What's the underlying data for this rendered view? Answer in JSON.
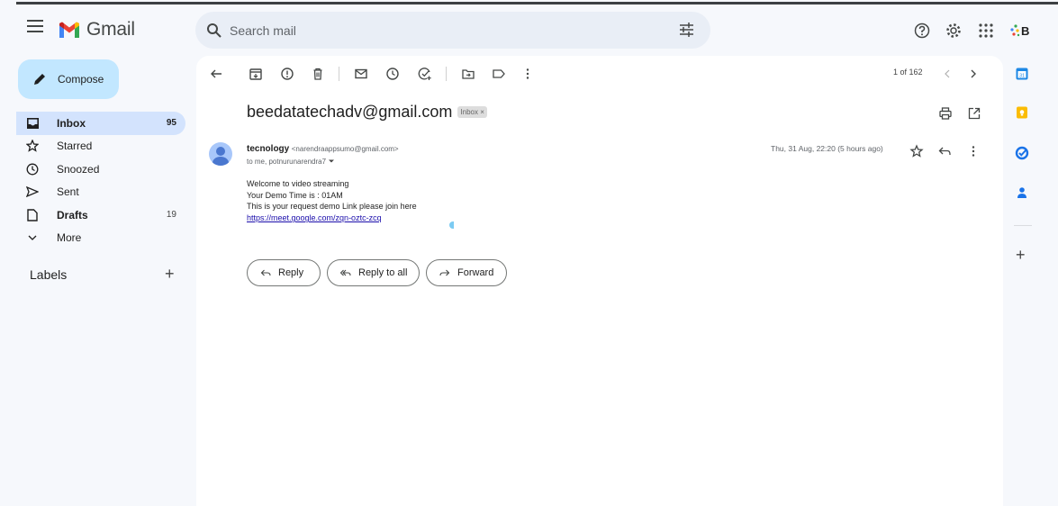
{
  "app": {
    "name": "Gmail"
  },
  "search": {
    "placeholder": "Search mail"
  },
  "account": {
    "initial": "B"
  },
  "sidebar": {
    "compose_label": "Compose",
    "items": [
      {
        "label": "Inbox",
        "count": "95",
        "icon": "inbox-icon"
      },
      {
        "label": "Starred",
        "count": "",
        "icon": "star-icon"
      },
      {
        "label": "Snoozed",
        "count": "",
        "icon": "clock-icon"
      },
      {
        "label": "Sent",
        "count": "",
        "icon": "send-icon"
      },
      {
        "label": "Drafts",
        "count": "19",
        "icon": "draft-icon"
      },
      {
        "label": "More",
        "count": "",
        "icon": "chevron-down-icon"
      }
    ],
    "labels_title": "Labels",
    "labels_add": "+"
  },
  "toolbar": {
    "pager": "1 of 162"
  },
  "message": {
    "subject": "beedatatechadv@gmail.com",
    "label_chip": "Inbox ×",
    "sender_name": "tecnology",
    "sender_email": "<narendraappsumo@gmail.com>",
    "to_line": "to me, potnurunarendra7",
    "date": "Thu, 31 Aug, 22:20 (5 hours ago)",
    "body_lines": [
      "Welcome to video streaming",
      "Your Demo Time is : 01AM",
      "This is your request demo Link please join here"
    ],
    "link": "https://meet.google.com/zqn-oztc-zcq"
  },
  "actions": {
    "reply": "Reply",
    "reply_all": "Reply to all",
    "forward": "Forward"
  },
  "colors": {
    "compose_bg": "#c2e7ff",
    "inbox_active": "#d3e3fd",
    "search_bg": "#e9eef6",
    "link": "#1a0dab"
  }
}
